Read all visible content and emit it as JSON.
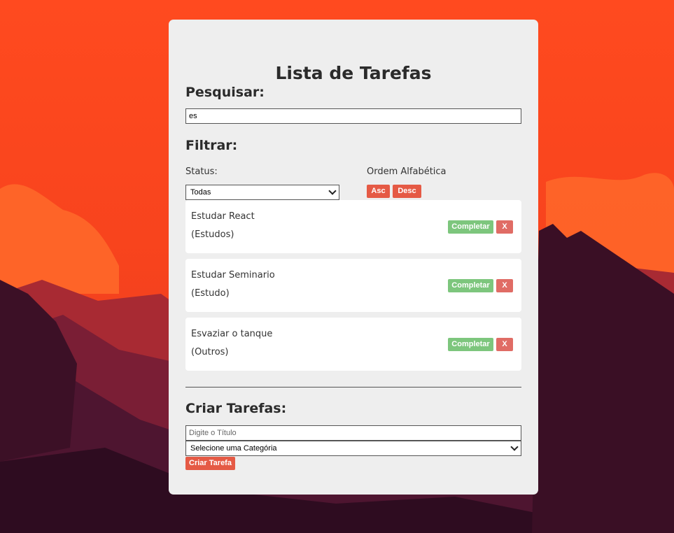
{
  "colors": {
    "sky": "#ff4a1f",
    "card": "#eeeeee",
    "primary_button": "#e55a45",
    "complete_button": "#7dc67d",
    "delete_button": "#e06c65"
  },
  "app": {
    "title": "Lista de Tarefas"
  },
  "search": {
    "heading": "Pesquisar:",
    "value": "es"
  },
  "filter": {
    "heading": "Filtrar:",
    "status_label": "Status:",
    "status_selected": "Todas",
    "order_label": "Ordem Alfabética",
    "asc_label": "Asc",
    "desc_label": "Desc"
  },
  "tasks": [
    {
      "title": "Estudar React",
      "category": "(Estudos)",
      "complete_label": "Completar",
      "delete_label": "X"
    },
    {
      "title": "Estudar Seminario",
      "category": "(Estudo)",
      "complete_label": "Completar",
      "delete_label": "X"
    },
    {
      "title": "Esvaziar o tanque",
      "category": "(Outros)",
      "complete_label": "Completar",
      "delete_label": "X"
    }
  ],
  "create": {
    "heading": "Criar Tarefas:",
    "title_placeholder": "Digite o Título",
    "category_selected": "Selecione uma Categória",
    "submit_label": "Criar Tarefa"
  }
}
